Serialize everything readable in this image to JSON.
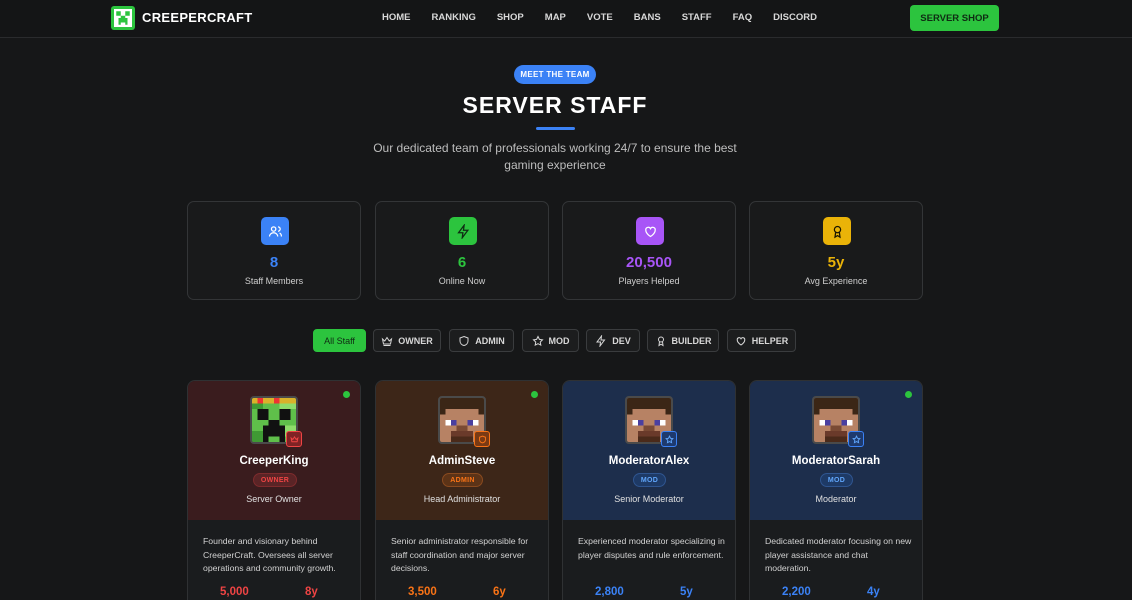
{
  "brand": {
    "name": "CREEPERCRAFT",
    "accent": "#2cc43e"
  },
  "nav": {
    "links": [
      "HOME",
      "RANKING",
      "SHOP",
      "MAP",
      "VOTE",
      "BANS",
      "STAFF",
      "FAQ",
      "DISCORD"
    ],
    "cta": "SERVER SHOP"
  },
  "hero": {
    "badge": "MEET THE TEAM",
    "title": "SERVER STAFF",
    "subtitle": "Our dedicated team of professionals working 24/7 to ensure the best gaming experience"
  },
  "stats": [
    {
      "value": "8",
      "label": "Staff Members",
      "icon": "users-icon",
      "color": "#3b82f6"
    },
    {
      "value": "6",
      "label": "Online Now",
      "icon": "lightning-icon",
      "color": "#2cc43e"
    },
    {
      "value": "20,500",
      "label": "Players Helped",
      "icon": "heart-icon",
      "color": "#a855f7"
    },
    {
      "value": "5y",
      "label": "Avg Experience",
      "icon": "award-icon",
      "color": "#eab308"
    }
  ],
  "filters": [
    {
      "label": "All Staff",
      "icon": "",
      "active": true
    },
    {
      "label": "OWNER",
      "icon": "crown-icon"
    },
    {
      "label": "ADMIN",
      "icon": "shield-icon"
    },
    {
      "label": "MOD",
      "icon": "star-icon"
    },
    {
      "label": "DEV",
      "icon": "lightning-icon"
    },
    {
      "label": "BUILDER",
      "icon": "award-icon"
    },
    {
      "label": "HELPER",
      "icon": "heart-icon"
    }
  ],
  "staff": [
    {
      "name": "CreeperKing",
      "role": "OWNER",
      "title": "Server Owner",
      "description": "Founder and visionary behind CreeperCraft. Oversees all server operations and community growth.",
      "stat1": "5,000",
      "stat2": "8y",
      "online": true,
      "color": "#ef4444"
    },
    {
      "name": "AdminSteve",
      "role": "ADMIN",
      "title": "Head Administrator",
      "description": "Senior administrator responsible for staff coordination and major server decisions.",
      "stat1": "3,500",
      "stat2": "6y",
      "online": true,
      "color": "#f97316"
    },
    {
      "name": "ModeratorAlex",
      "role": "MOD",
      "title": "Senior Moderator",
      "description": "Experienced moderator specializing in player disputes and rule enforcement.",
      "stat1": "2,800",
      "stat2": "5y",
      "online": false,
      "color": "#3b82f6"
    },
    {
      "name": "ModeratorSarah",
      "role": "MOD",
      "title": "Moderator",
      "description": "Dedicated moderator focusing on new player assistance and chat moderation.",
      "stat1": "2,200",
      "stat2": "4y",
      "online": true,
      "color": "#3b82f6"
    }
  ]
}
